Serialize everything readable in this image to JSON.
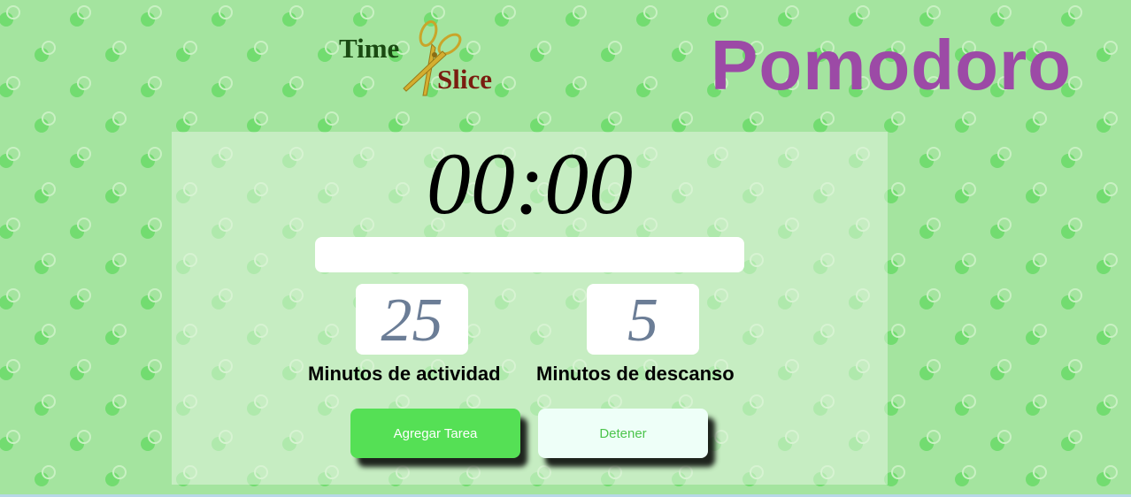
{
  "logo": {
    "word1": "Time",
    "word2": "Slice",
    "icon": "scissors-icon"
  },
  "header": {
    "title": "Pomodoro"
  },
  "timer": {
    "display": "00:00",
    "progress": 0
  },
  "settings": {
    "work_minutes": "25",
    "work_label": "Minutos de actividad",
    "break_minutes": "5",
    "break_label": "Minutos de descanso"
  },
  "buttons": {
    "add_task": "Agregar Tarea",
    "stop": "Detener"
  },
  "colors": {
    "background": "#a4e49f",
    "title": "#9c4aa6",
    "add_button": "#55e055",
    "stop_button": "#eefff8",
    "stop_text": "#4cc44c",
    "minute_text": "#6b7d96"
  }
}
